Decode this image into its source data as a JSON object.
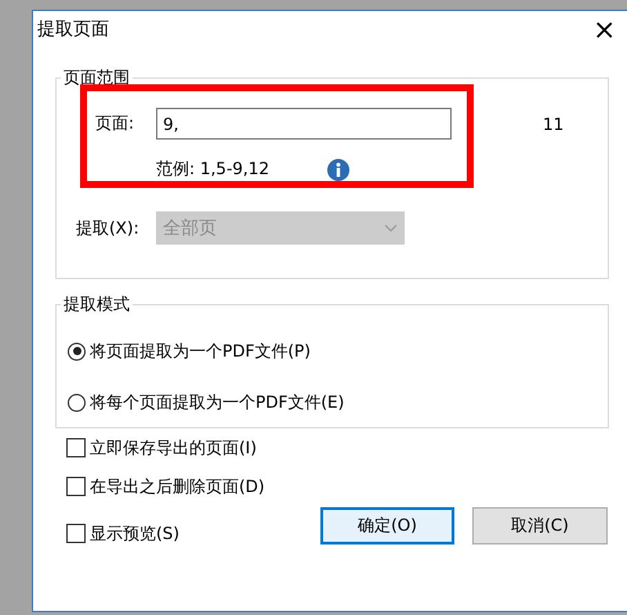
{
  "window": {
    "title": "提取页面",
    "close": "×"
  },
  "page_range": {
    "title": "页面范围",
    "pages_label": "页面:",
    "pages_value": "9,",
    "page_count": "11",
    "example": "范例: 1,5-9,12",
    "extract_label": "提取(X):",
    "extract_value": "全部页",
    "extract_disabled": true
  },
  "mode": {
    "title": "提取模式",
    "options": [
      {
        "label": "将页面提取为一个PDF文件(P)",
        "selected": true
      },
      {
        "label": "将每个页面提取为一个PDF文件(E)",
        "selected": false
      }
    ]
  },
  "options": [
    {
      "label": "立即保存导出的页面(I)",
      "checked": false
    },
    {
      "label": "在导出之后删除页面(D)",
      "checked": false
    }
  ],
  "preview": {
    "label": "显示预览(S)",
    "checked": false
  },
  "buttons": [
    {
      "label": "确定(O)",
      "default": true
    },
    {
      "label": "取消(C)",
      "default": false
    }
  ],
  "highlight": true
}
